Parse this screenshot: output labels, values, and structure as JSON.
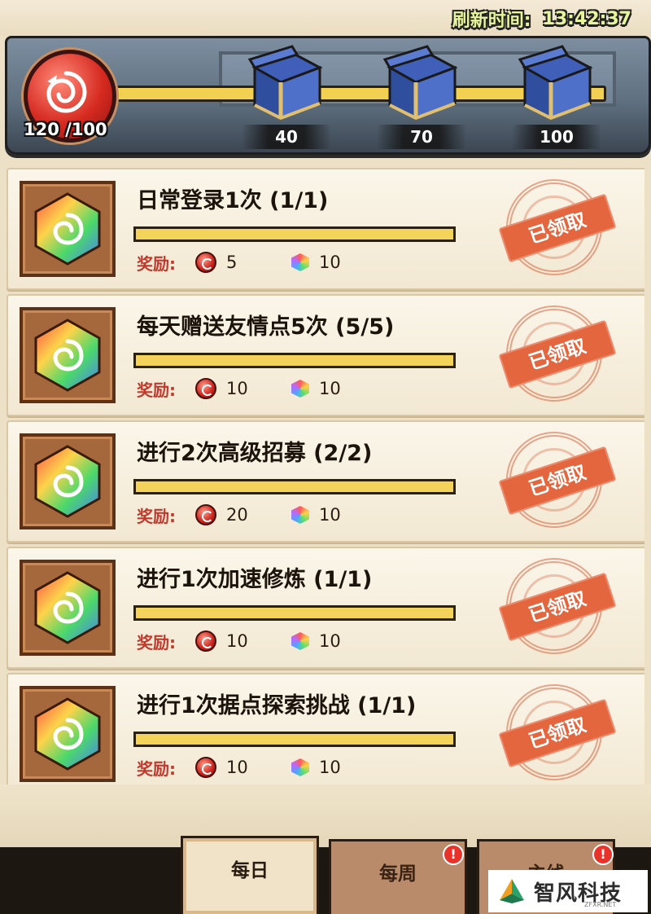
{
  "header": {
    "refresh_label": "刷新时间:",
    "refresh_time": "13:42:37"
  },
  "progress": {
    "current_points": "120 /100",
    "chests": [
      {
        "threshold": "40",
        "icon": "treasure-chest-icon"
      },
      {
        "threshold": "70",
        "icon": "treasure-chest-icon"
      },
      {
        "threshold": "100",
        "icon": "treasure-chest-icon"
      }
    ],
    "fill_fraction": 1.0
  },
  "tasks": [
    {
      "title": "日常登录1次 (1/1)",
      "reward_label": "奖励:",
      "scroll_reward": "5",
      "gem_reward": "10",
      "status": "已领取",
      "progress_fraction": 1.0
    },
    {
      "title": "每天赠送友情点5次 (5/5)",
      "reward_label": "奖励:",
      "scroll_reward": "10",
      "gem_reward": "10",
      "status": "已领取",
      "progress_fraction": 1.0
    },
    {
      "title": "进行2次高级招募 (2/2)",
      "reward_label": "奖励:",
      "scroll_reward": "20",
      "gem_reward": "10",
      "status": "已领取",
      "progress_fraction": 1.0
    },
    {
      "title": "进行1次加速修炼 (1/1)",
      "reward_label": "奖励:",
      "scroll_reward": "10",
      "gem_reward": "10",
      "status": "已领取",
      "progress_fraction": 1.0
    },
    {
      "title": "进行1次据点探索挑战 (1/1)",
      "reward_label": "奖励:",
      "scroll_reward": "10",
      "gem_reward": "10",
      "status": "已领取",
      "progress_fraction": 1.0
    }
  ],
  "tabs": [
    {
      "label": "每日",
      "active": true,
      "alert": false
    },
    {
      "label": "每周",
      "active": false,
      "alert": true
    },
    {
      "label": "主线",
      "active": false,
      "alert": true
    }
  ],
  "alert_mark": "!",
  "watermark": {
    "brand": "智风科技",
    "sub": "ZFXR.NET"
  },
  "colors": {
    "stamp": "#e4663f",
    "progress_fill": "#f3d35a",
    "leaf_badge": "#d62a20",
    "refresh_text": "#e9f59a"
  }
}
